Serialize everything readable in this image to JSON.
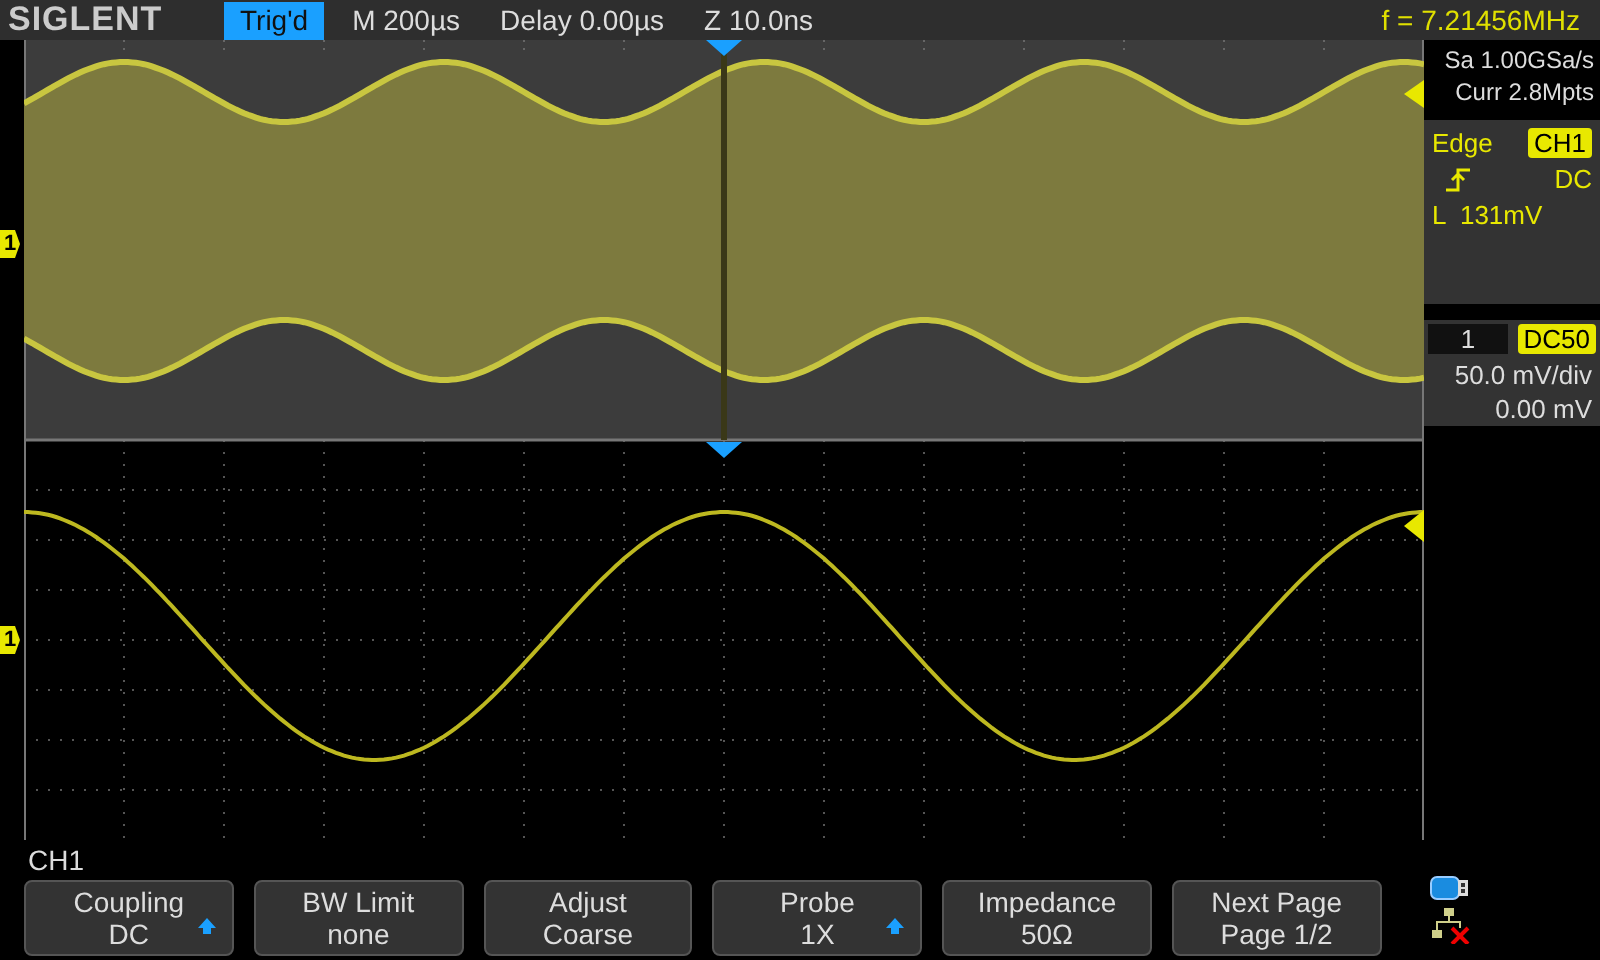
{
  "top_bar": {
    "brand": "SIGLENT",
    "trigger_status": "Trig'd",
    "timebase": "M 200µs",
    "delay": "Delay 0.00µs",
    "zoom": "Z 10.0ns",
    "frequency": "f = 7.21456MHz"
  },
  "channel_markers": [
    "1",
    "1"
  ],
  "acquisition": {
    "sample_rate": "Sa 1.00GSa/s",
    "memory": "Curr 2.8Mpts"
  },
  "trigger": {
    "type": "Edge",
    "source": "CH1",
    "coupling": "DC",
    "level": "L  131mV"
  },
  "channel": {
    "number": "1",
    "impedance": "DC50",
    "scale": "50.0 mV/div",
    "offset": "0.00 mV"
  },
  "menu": {
    "title": "CH1",
    "buttons": [
      {
        "label": "Coupling",
        "value": "DC",
        "arrow": true
      },
      {
        "label": "BW Limit",
        "value": "none",
        "arrow": false
      },
      {
        "label": "Adjust",
        "value": "Coarse",
        "arrow": false
      },
      {
        "label": "Probe",
        "value": "1X",
        "arrow": true
      },
      {
        "label": "Impedance",
        "value": "50Ω",
        "arrow": false
      },
      {
        "label": "Next Page",
        "value": "Page 1/2",
        "arrow": false
      }
    ]
  }
}
